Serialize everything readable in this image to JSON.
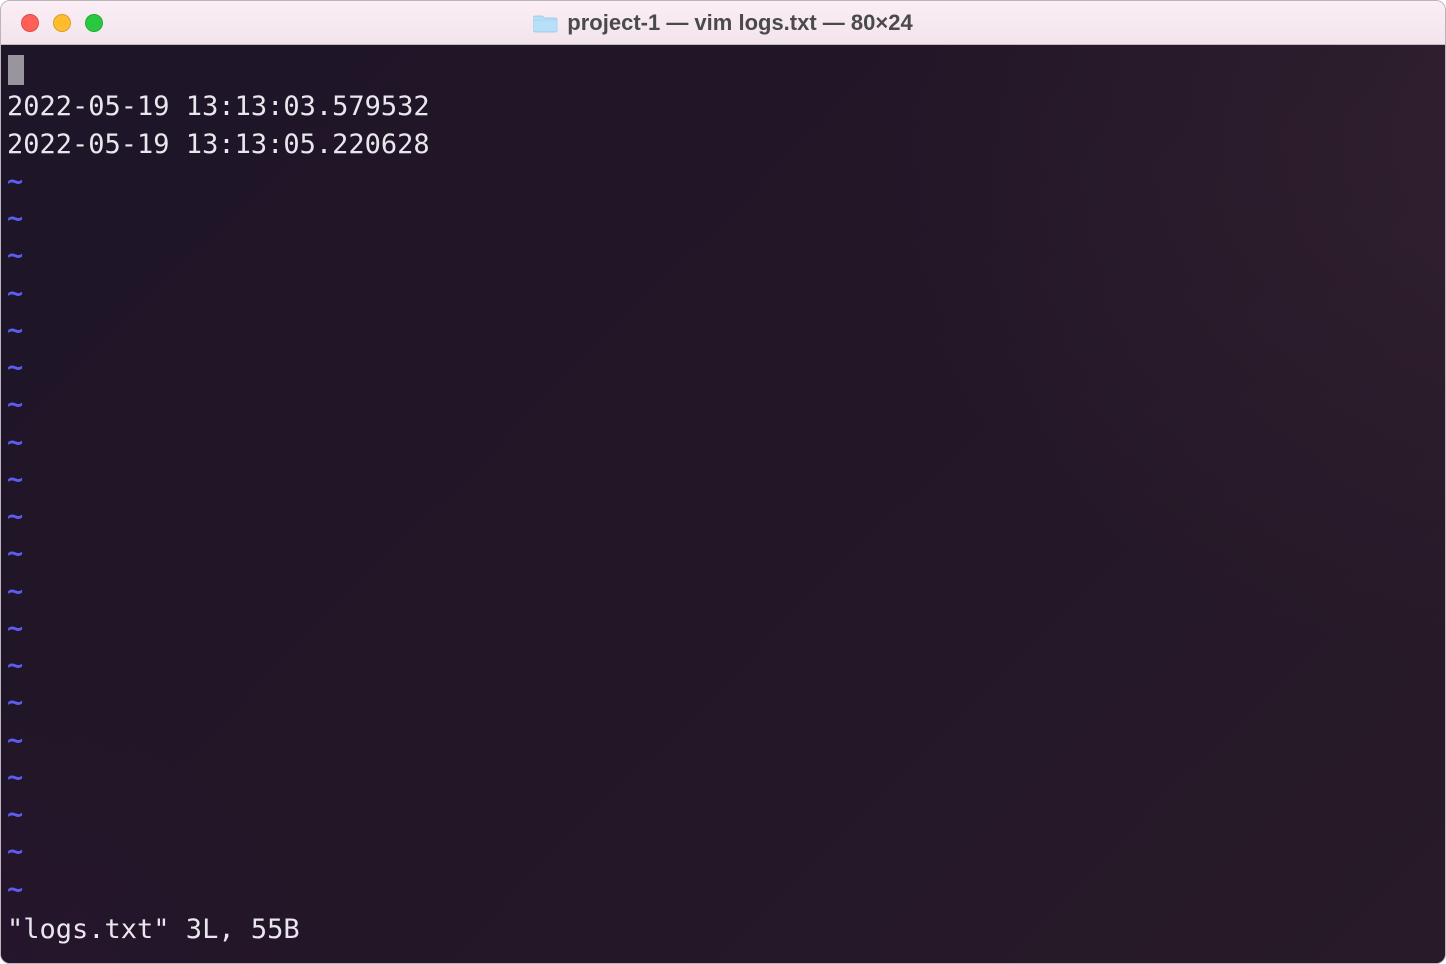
{
  "window": {
    "title": "project-1 — vim logs.txt — 80×24"
  },
  "buffer": {
    "lines": [
      "",
      "2022-05-19 13:13:03.579532",
      "2022-05-19 13:13:05.220628"
    ]
  },
  "tilde": "~",
  "tilde_count": 20,
  "status": "\"logs.txt\" 3L, 55B"
}
